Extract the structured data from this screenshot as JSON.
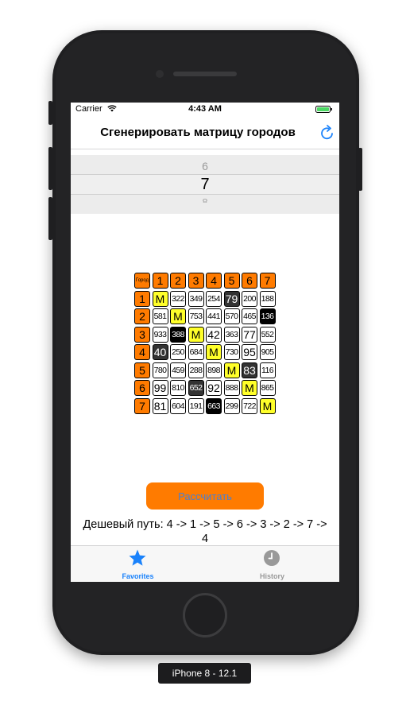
{
  "status_bar": {
    "carrier": "Carrier",
    "time": "4:43 AM"
  },
  "navbar": {
    "title": "Сгенерировать матрицу городов",
    "action_icon": "refresh-icon"
  },
  "picker": {
    "above": "6",
    "selected": "7",
    "below": "8"
  },
  "matrix": {
    "corner": "Город",
    "headers": [
      "1",
      "2",
      "3",
      "4",
      "5",
      "6",
      "7"
    ],
    "rows": [
      [
        "M",
        "322",
        "349",
        "254",
        "79",
        "200",
        "188"
      ],
      [
        "581",
        "M",
        "753",
        "441",
        "570",
        "465",
        "136"
      ],
      [
        "933",
        "388",
        "M",
        "42",
        "363",
        "77",
        "552"
      ],
      [
        "40",
        "250",
        "684",
        "M",
        "730",
        "95",
        "905"
      ],
      [
        "780",
        "459",
        "288",
        "898",
        "M",
        "83",
        "116"
      ],
      [
        "99",
        "810",
        "652",
        "92",
        "888",
        "M",
        "865"
      ],
      [
        "81",
        "604",
        "191",
        "663",
        "299",
        "722",
        "M"
      ]
    ],
    "cell_styles": [
      [
        "diag",
        "w",
        "w",
        "w",
        "dark",
        "w",
        "w"
      ],
      [
        "w",
        "diag",
        "w",
        "w",
        "w",
        "w",
        "black"
      ],
      [
        "w",
        "black",
        "diag",
        "w",
        "w",
        "w",
        "w"
      ],
      [
        "dark",
        "w",
        "w",
        "diag",
        "w",
        "w",
        "w"
      ],
      [
        "w",
        "w",
        "w",
        "w",
        "diag",
        "dark",
        "w"
      ],
      [
        "w",
        "w",
        "dark",
        "w",
        "w",
        "diag",
        "w"
      ],
      [
        "w",
        "w",
        "w",
        "black",
        "w",
        "w",
        "diag"
      ]
    ],
    "colors": {
      "header": "#ff7b00",
      "diagonal": "#ffff2a",
      "dark": "#333333",
      "black": "#000000"
    }
  },
  "calculate_button": {
    "label": "Рассчитать",
    "color": "#ff7b00"
  },
  "result": {
    "text": "Дешевый путь:  4 -> 1 -> 5 -> 6 -> 3 -> 2 -> 7 -> 4"
  },
  "tabbar": {
    "tabs": [
      {
        "label": "Favorites",
        "icon": "star-icon",
        "active": true,
        "color": "#1a82fb"
      },
      {
        "label": "History",
        "icon": "clock-icon",
        "active": false,
        "color": "#999999"
      }
    ]
  },
  "device_label": "iPhone 8 - 12.1"
}
